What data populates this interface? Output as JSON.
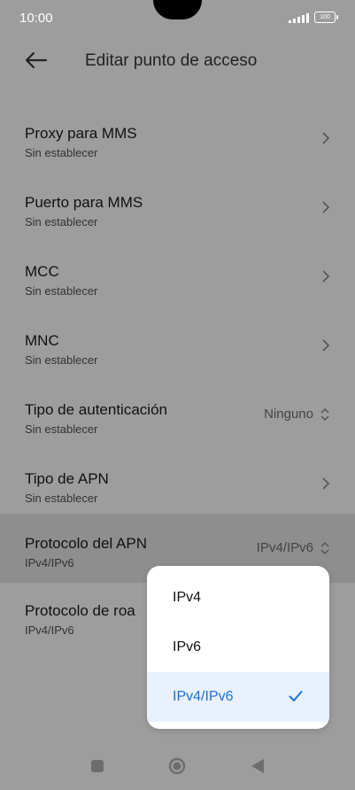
{
  "status": {
    "time": "10:00",
    "battery": "100"
  },
  "header": {
    "title": "Editar punto de acceso"
  },
  "rows": [
    {
      "label": "Proxy para MMS",
      "sub": "Sin establecer"
    },
    {
      "label": "Puerto para MMS",
      "sub": "Sin establecer"
    },
    {
      "label": "MCC",
      "sub": "Sin establecer"
    },
    {
      "label": "MNC",
      "sub": "Sin establecer"
    },
    {
      "label": "Tipo de autenticación",
      "sub": "Sin establecer",
      "value": "Ninguno"
    },
    {
      "label": "Tipo de APN",
      "sub": "Sin establecer"
    },
    {
      "label": "Protocolo del APN",
      "sub": "IPv4/IPv6",
      "value": "IPv4/IPv6"
    },
    {
      "label": "Protocolo de roa",
      "sub": "IPv4/IPv6"
    }
  ],
  "dropdown": {
    "options": [
      "IPv4",
      "IPv6",
      "IPv4/IPv6"
    ],
    "selected": "IPv4/IPv6"
  },
  "colors": {
    "accent": "#1a73d8",
    "scrim": "#9d9d9d",
    "popup_bg": "#ffffff",
    "selected_option_bg": "#e8f1fc"
  },
  "icons": {
    "back": "arrow-left-icon",
    "chevron": "chevron-right-icon",
    "updown": "chevron-up-down-icon",
    "check": "check-icon",
    "signal": "signal-icon",
    "battery": "battery-icon",
    "recents": "square-icon",
    "home": "circle-icon",
    "nav_back": "triangle-back-icon"
  }
}
